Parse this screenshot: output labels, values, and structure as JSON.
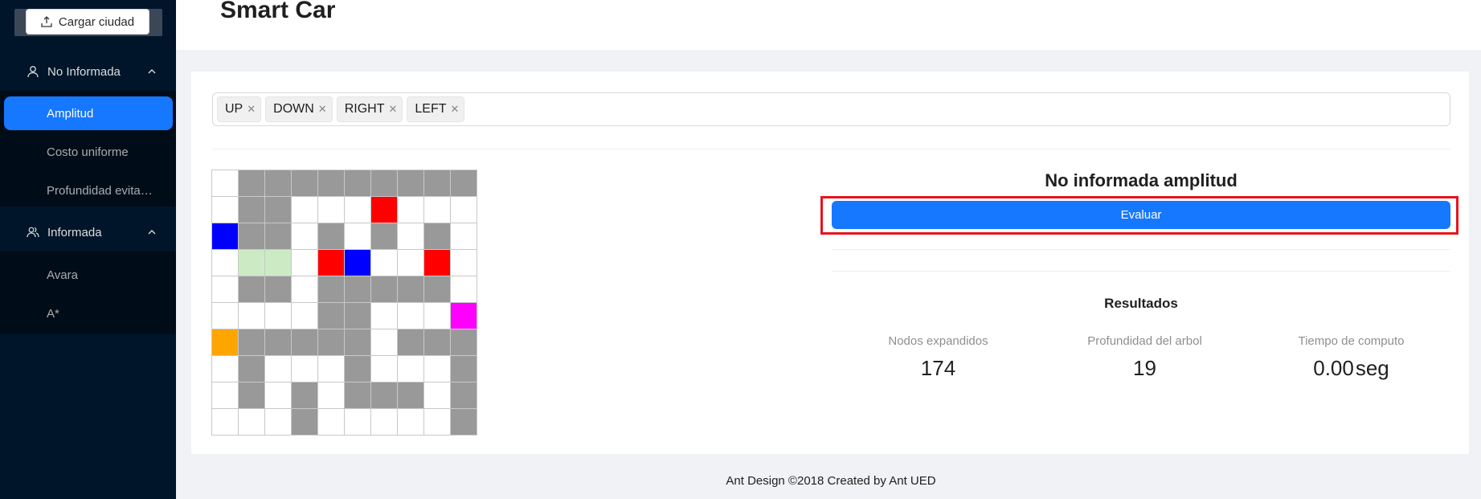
{
  "sidebar": {
    "upload_label": "Cargar ciudad",
    "groups": [
      {
        "title": "No Informada",
        "items": [
          "Amplitud",
          "Costo uniforme",
          "Profundidad evitando ciclos"
        ]
      },
      {
        "title": "Informada",
        "items": [
          "Avara",
          "A*"
        ]
      }
    ],
    "selected": "Amplitud"
  },
  "header": {
    "title": "Smart Car"
  },
  "operators": {
    "tags": [
      "UP",
      "DOWN",
      "RIGHT",
      "LEFT"
    ]
  },
  "grid": {
    "legend": {
      "0": "#ffffff",
      "1": "#999999",
      "2": "#ff0000",
      "3": "#0000ff",
      "4": "#ccebc5",
      "5": "#ff00ff",
      "6": "#ffa500"
    },
    "rows": [
      [
        0,
        1,
        1,
        1,
        1,
        1,
        1,
        1,
        1,
        1
      ],
      [
        0,
        1,
        1,
        0,
        0,
        0,
        2,
        0,
        0,
        0
      ],
      [
        3,
        1,
        1,
        0,
        1,
        0,
        1,
        0,
        1,
        0
      ],
      [
        0,
        4,
        4,
        0,
        2,
        3,
        0,
        0,
        2,
        0
      ],
      [
        0,
        1,
        1,
        0,
        1,
        1,
        1,
        1,
        1,
        0
      ],
      [
        0,
        0,
        0,
        0,
        1,
        1,
        0,
        0,
        0,
        5
      ],
      [
        6,
        1,
        1,
        1,
        1,
        1,
        0,
        1,
        1,
        1
      ],
      [
        0,
        1,
        0,
        0,
        0,
        1,
        0,
        0,
        0,
        1
      ],
      [
        0,
        1,
        0,
        1,
        0,
        1,
        1,
        1,
        0,
        1
      ],
      [
        0,
        0,
        0,
        1,
        0,
        0,
        0,
        0,
        0,
        1
      ]
    ]
  },
  "panel": {
    "title": "No informada amplitud",
    "evaluate_label": "Evaluar",
    "results_title": "Resultados",
    "stats": [
      {
        "label": "Nodos expandidos",
        "value": "174",
        "suffix": ""
      },
      {
        "label": "Profundidad del arbol",
        "value": "19",
        "suffix": ""
      },
      {
        "label": "Tiempo de computo",
        "value": "0.00",
        "suffix": "seg"
      }
    ]
  },
  "footer": {
    "text": "Ant Design ©2018 Created by Ant UED"
  }
}
